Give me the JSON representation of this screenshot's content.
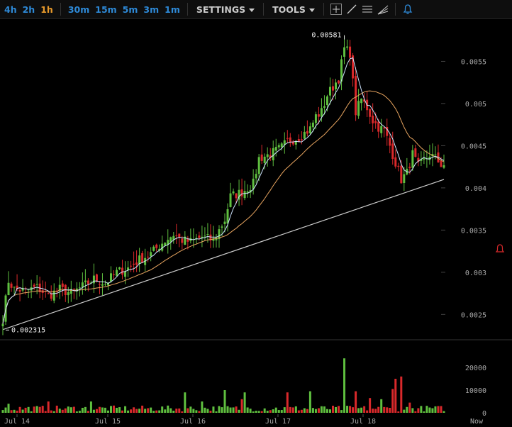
{
  "toolbar": {
    "timeframes": [
      {
        "label": "4h",
        "active": false
      },
      {
        "label": "2h",
        "active": false
      },
      {
        "label": "1h",
        "active": true
      },
      {
        "label": "30m",
        "active": false
      },
      {
        "label": "15m",
        "active": false
      },
      {
        "label": "5m",
        "active": false
      },
      {
        "label": "3m",
        "active": false
      },
      {
        "label": "1m",
        "active": false
      }
    ],
    "settings_label": "SETTINGS",
    "tools_label": "TOOLS",
    "tool_icons": [
      "crosshair-icon",
      "trendline-icon",
      "horizontal-lines-icon",
      "fan-icon"
    ],
    "alert_icon": "bell-icon"
  },
  "chart_data": {
    "type": "candlestick",
    "price_axis": {
      "ticks": [
        "0.0055",
        "0.005",
        "0.0045",
        "0.004",
        "0.0035",
        "0.003",
        "0.0025"
      ],
      "ylim": [
        0.0022,
        0.006
      ]
    },
    "volume_axis": {
      "ticks": [
        "20000",
        "10000",
        "0"
      ],
      "ylim": [
        0,
        25000
      ]
    },
    "x_ticks": [
      "Jul 14",
      "Jul 15",
      "Jul 16",
      "Jul 17",
      "Jul 18",
      "Now"
    ],
    "high_label": "0.00581",
    "low_label": "0.002315",
    "colors": {
      "up": "#5fbf3f",
      "down": "#d9292b",
      "ma_fast": "#cfe4ff",
      "ma_slow": "#e8a560",
      "trendline": "#cccccc",
      "alert": "#d9292b"
    },
    "anchors": [
      [
        0,
        0.00245
      ],
      [
        2,
        0.0029
      ],
      [
        4,
        0.0028
      ],
      [
        8,
        0.00278
      ],
      [
        12,
        0.00282
      ],
      [
        16,
        0.00272
      ],
      [
        20,
        0.0028
      ],
      [
        24,
        0.00275
      ],
      [
        28,
        0.00283
      ],
      [
        32,
        0.00292
      ],
      [
        36,
        0.00287
      ],
      [
        40,
        0.003
      ],
      [
        44,
        0.00305
      ],
      [
        48,
        0.00315
      ],
      [
        52,
        0.00322
      ],
      [
        56,
        0.00335
      ],
      [
        60,
        0.00345
      ],
      [
        63,
        0.00338
      ],
      [
        66,
        0.00336
      ],
      [
        70,
        0.00342
      ],
      [
        74,
        0.00338
      ],
      [
        78,
        0.00362
      ],
      [
        80,
        0.0039
      ],
      [
        84,
        0.00395
      ],
      [
        88,
        0.00405
      ],
      [
        90,
        0.00435
      ],
      [
        94,
        0.0044
      ],
      [
        98,
        0.00448
      ],
      [
        100,
        0.00455
      ],
      [
        104,
        0.0046
      ],
      [
        108,
        0.0047
      ],
      [
        110,
        0.00485
      ],
      [
        112,
        0.0049
      ],
      [
        114,
        0.0051
      ],
      [
        116,
        0.0052
      ],
      [
        118,
        0.0053
      ],
      [
        120,
        0.00565
      ],
      [
        122,
        0.0056
      ],
      [
        124,
        0.0049
      ],
      [
        126,
        0.00505
      ],
      [
        128,
        0.00495
      ],
      [
        130,
        0.0048
      ],
      [
        132,
        0.00472
      ],
      [
        134,
        0.00468
      ],
      [
        136,
        0.0045
      ],
      [
        138,
        0.0043
      ],
      [
        140,
        0.0041
      ],
      [
        142,
        0.00418
      ],
      [
        144,
        0.0044
      ],
      [
        146,
        0.00425
      ],
      [
        148,
        0.00432
      ],
      [
        150,
        0.0044
      ],
      [
        152,
        0.00435
      ],
      [
        154,
        0.00428
      ]
    ],
    "volume_spikes": [
      [
        2,
        4000
      ],
      [
        16,
        5000
      ],
      [
        31,
        5000
      ],
      [
        64,
        9000
      ],
      [
        70,
        5000
      ],
      [
        78,
        10000
      ],
      [
        84,
        6000
      ],
      [
        85,
        9000
      ],
      [
        100,
        9000
      ],
      [
        108,
        9500
      ],
      [
        120,
        24000
      ],
      [
        124,
        9500
      ],
      [
        129,
        6500
      ],
      [
        133,
        6000
      ],
      [
        137,
        10500
      ],
      [
        138,
        15000
      ],
      [
        140,
        16000
      ],
      [
        143,
        4500
      ]
    ],
    "trendline": [
      [
        0,
        0.00232
      ],
      [
        155,
        0.0041
      ]
    ]
  }
}
